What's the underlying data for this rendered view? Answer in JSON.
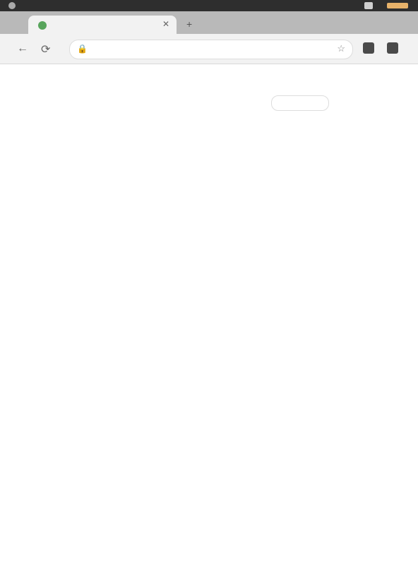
{
  "status": {
    "time": "",
    "battery_color": "#e7b26a"
  },
  "browser": {
    "tab_title": "",
    "url": "",
    "colors": {
      "tabstrip": "#b9b9b9",
      "toolbar": "#f2f2f2",
      "link": "#2e6bd6"
    },
    "icons": [
      "back-icon",
      "refresh-icon",
      "lock-icon",
      "star-icon",
      "extension-icon",
      "menu-icon",
      "close-icon",
      "plus-icon"
    ]
  },
  "scope_tabs": [
    "",
    "",
    "",
    ""
  ],
  "intro_paragraph": {
    "bold": "",
    "text": ""
  },
  "infobox": {
    "line1": "",
    "line2": "",
    "meta": "",
    "pill": "",
    "button": ""
  },
  "results": [
    {
      "lines": [
        "",
        ""
      ]
    },
    {
      "lines": [
        "",
        "",
        ""
      ]
    },
    {
      "lines": [
        "",
        "",
        "",
        ""
      ]
    },
    {
      "lines": [
        "",
        "",
        ""
      ]
    },
    {
      "lines": [
        "",
        ""
      ]
    },
    {
      "lines": [
        "",
        ""
      ]
    },
    {
      "lines": [
        "",
        "",
        ""
      ]
    },
    {
      "lines": [
        "",
        ""
      ]
    },
    {
      "lines": [
        "",
        ""
      ]
    },
    {
      "lines": [
        ""
      ]
    }
  ]
}
